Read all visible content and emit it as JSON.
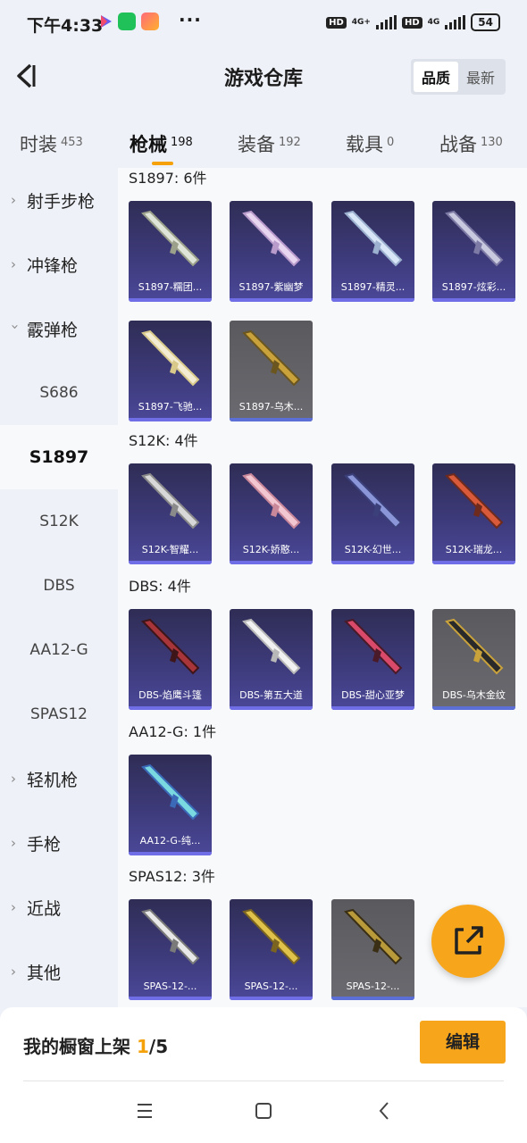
{
  "status_bar": {
    "time": "下午4:33",
    "net1": "4G+",
    "net2": "4G",
    "battery": "54",
    "hd": "HD"
  },
  "header": {
    "title": "游戏仓库",
    "sort_options": [
      "品质",
      "最新"
    ]
  },
  "tabs": [
    {
      "label": "时装",
      "count": "453"
    },
    {
      "label": "枪械",
      "count": "198"
    },
    {
      "label": "装备",
      "count": "192"
    },
    {
      "label": "载具",
      "count": "0"
    },
    {
      "label": "战备",
      "count": "130"
    }
  ],
  "sidebar": {
    "categories": [
      "射手步枪",
      "冲锋枪",
      "霰弹枪",
      "轻机枪",
      "手枪",
      "近战",
      "其他"
    ],
    "subcategories": [
      "S686",
      "S1897",
      "S12K",
      "DBS",
      "AA12-G",
      "SPAS12"
    ]
  },
  "sections": [
    {
      "title": "S1897: 6件",
      "items": [
        "S1897-糯团...",
        "S1897-紫幽梦",
        "S1897-精灵...",
        "S1897-炫彩...",
        "S1897-飞驰...",
        "S1897-乌木..."
      ]
    },
    {
      "title": "S12K: 4件",
      "items": [
        "S12K-智耀...",
        "S12K-娇憨...",
        "S12K-幻世...",
        "S12K-瑞龙..."
      ]
    },
    {
      "title": "DBS: 4件",
      "items": [
        "DBS-焰鹰斗篷",
        "DBS-第五大道",
        "DBS-甜心亚梦",
        "DBS-乌木金纹"
      ]
    },
    {
      "title": "AA12-G: 1件",
      "items": [
        "AA12-G-纯..."
      ]
    },
    {
      "title": "SPAS12: 3件",
      "items": [
        "SPAS-12-...",
        "SPAS-12-...",
        "SPAS-12-..."
      ]
    }
  ],
  "showcase": {
    "label": "我的橱窗上架",
    "current": "1",
    "total": "/5",
    "edit_label": "编辑"
  },
  "colors": {
    "accent": "#f7a61c",
    "card_purple": "#3d3a7a",
    "card_gray": "#66666b"
  },
  "icons": {
    "back": "chevron-left-icon",
    "share": "share-external-icon",
    "nav": [
      "menu-icon",
      "home-icon",
      "back-icon"
    ]
  }
}
